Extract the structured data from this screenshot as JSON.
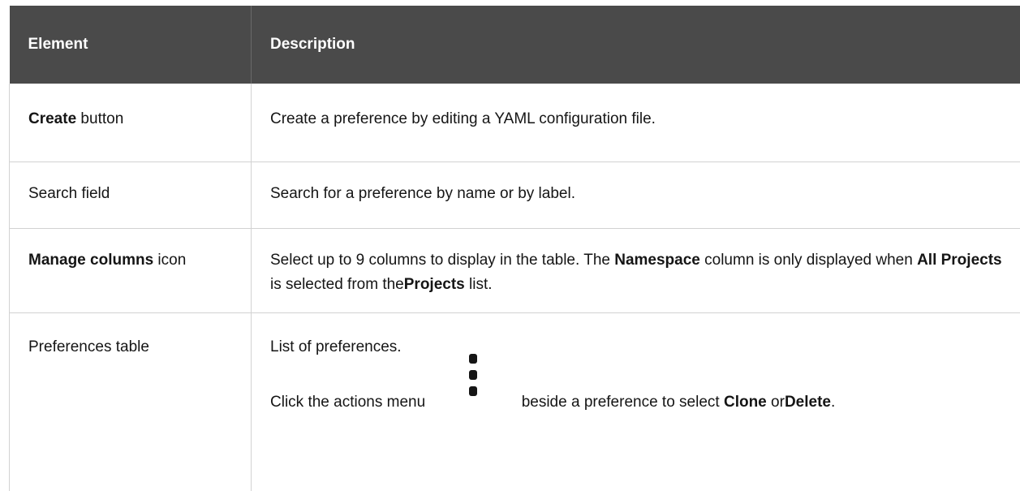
{
  "table": {
    "headers": {
      "element": "Element",
      "description": "Description"
    },
    "rows": [
      {
        "element_strong": "Create",
        "element_rest": " button",
        "description": "Create a preference by editing a YAML configuration file."
      },
      {
        "element_strong": "",
        "element_rest": "Search field",
        "description": "Search for a preference by name or by label."
      },
      {
        "element_strong": "Manage columns",
        "element_rest": " icon",
        "description_parts": {
          "p1": "Select up to 9 columns to display in the table. The ",
          "s1": "Namespace",
          "p2": " column is only displayed when ",
          "s2": "All Projects",
          "p3": " is selected from the",
          "s3": "Projects",
          "p4": " list."
        }
      },
      {
        "element_strong": "",
        "element_rest": "Preferences table",
        "description_line1": "List of preferences.",
        "description_line2": {
          "p1": "Click the actions menu ",
          "p2": " beside a preference to select ",
          "s1": "Clone",
          "p3": " or",
          "s2": "Delete",
          "p4": "."
        },
        "icon": "kebab-menu-icon"
      }
    ]
  }
}
